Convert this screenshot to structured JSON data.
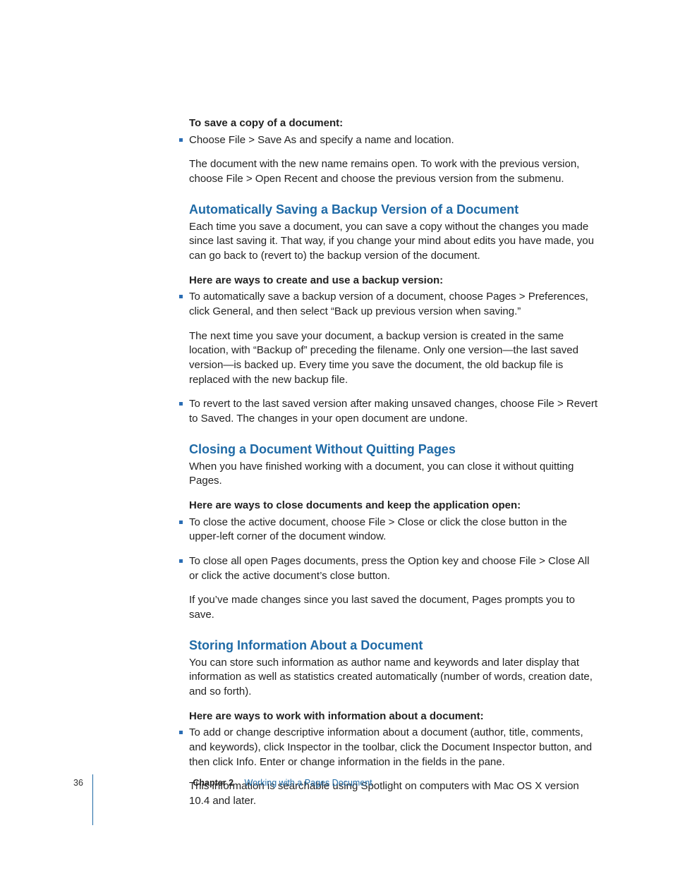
{
  "intro": {
    "lead": "To save a copy of a document:",
    "bullet1": "Choose File > Save As and specify a name and location.",
    "follow1": "The document with the new name remains open. To work with the previous version, choose File > Open Recent and choose the previous version from the submenu."
  },
  "section1": {
    "heading": "Automatically Saving a Backup Version of a Document",
    "intro": "Each time you save a document, you can save a copy without the changes you made since last saving it. That way, if you change your mind about edits you have made, you can go back to (revert to) the backup version of the document.",
    "lead": "Here are ways to create and use a backup version:",
    "bullet1": "To automatically save a backup version of a document, choose Pages > Preferences, click General, and then select “Back up previous version when saving.”",
    "follow1": "The next time you save your document, a backup version is created in the same location, with “Backup of” preceding the filename. Only one version—the last saved version—is backed up. Every time you save the document, the old backup file is replaced with the new backup file.",
    "bullet2": "To revert to the last saved version after making unsaved changes, choose File > Revert to Saved. The changes in your open document are undone."
  },
  "section2": {
    "heading": "Closing a Document Without Quitting Pages",
    "intro": "When you have finished working with a document, you can close it without quitting Pages.",
    "lead": "Here are ways to close documents and keep the application open:",
    "bullet1": "To close the active document, choose File > Close or click the close button in the upper-left corner of the document window.",
    "bullet2": "To close all open Pages documents, press the Option key and choose File > Close All or click the active document’s close button.",
    "follow2": "If you’ve made changes since you last saved the document, Pages prompts you to save."
  },
  "section3": {
    "heading": "Storing Information About a Document",
    "intro": "You can store such information as author name and keywords and later display that information as well as statistics created automatically (number of words, creation date, and so forth).",
    "lead": "Here are ways to work with information about a document:",
    "bullet1": "To add or change descriptive information about a document (author, title, comments, and keywords), click Inspector in the toolbar, click the Document Inspector button, and then click Info. Enter or change information in the fields in the pane.",
    "follow1": "This information is searchable using Spotlight on computers with Mac OS X version 10.4 and later."
  },
  "footer": {
    "page": "36",
    "chapter_label": "Chapter 2",
    "chapter_title": "Working with a Pages Document"
  }
}
